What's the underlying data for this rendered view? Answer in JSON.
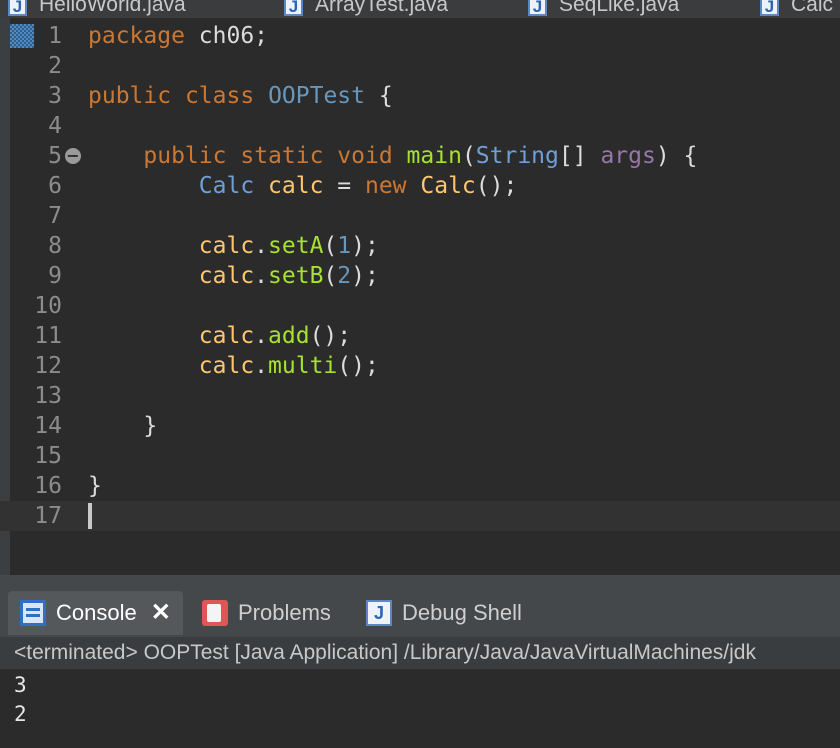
{
  "editor_tabs": [
    "HelloWorld.java",
    "ArrayTest.java",
    "SeqLike.java",
    "Calc"
  ],
  "editor_tab_icon": "J",
  "code_lines": [
    {
      "n": "1",
      "tokens": [
        {
          "t": "package",
          "c": "kw"
        },
        {
          "t": " ch06;",
          "c": "pnc"
        }
      ]
    },
    {
      "n": "2",
      "tokens": []
    },
    {
      "n": "3",
      "tokens": [
        {
          "t": "public",
          "c": "kw"
        },
        {
          "t": " ",
          "c": "pnc"
        },
        {
          "t": "class",
          "c": "kw"
        },
        {
          "t": " ",
          "c": "pnc"
        },
        {
          "t": "OOPTest",
          "c": "cls"
        },
        {
          "t": " {",
          "c": "pnc"
        }
      ]
    },
    {
      "n": "4",
      "tokens": []
    },
    {
      "n": "5",
      "fold": true,
      "tokens": [
        {
          "t": "    ",
          "c": "pnc"
        },
        {
          "t": "public",
          "c": "kw"
        },
        {
          "t": " ",
          "c": "pnc"
        },
        {
          "t": "static",
          "c": "kw"
        },
        {
          "t": " ",
          "c": "pnc"
        },
        {
          "t": "void",
          "c": "kw"
        },
        {
          "t": " ",
          "c": "pnc"
        },
        {
          "t": "main",
          "c": "mth"
        },
        {
          "t": "(",
          "c": "pnc"
        },
        {
          "t": "String",
          "c": "typ"
        },
        {
          "t": "[] ",
          "c": "pnc"
        },
        {
          "t": "args",
          "c": "prm"
        },
        {
          "t": ") {",
          "c": "pnc"
        }
      ]
    },
    {
      "n": "6",
      "tokens": [
        {
          "t": "        ",
          "c": "pnc"
        },
        {
          "t": "Calc",
          "c": "typ"
        },
        {
          "t": " ",
          "c": "pnc"
        },
        {
          "t": "calc",
          "c": "var"
        },
        {
          "t": " = ",
          "c": "pnc"
        },
        {
          "t": "new",
          "c": "kw"
        },
        {
          "t": " ",
          "c": "pnc"
        },
        {
          "t": "Calc",
          "c": "var"
        },
        {
          "t": "();",
          "c": "pnc"
        }
      ]
    },
    {
      "n": "7",
      "tokens": []
    },
    {
      "n": "8",
      "tokens": [
        {
          "t": "        ",
          "c": "pnc"
        },
        {
          "t": "calc",
          "c": "var"
        },
        {
          "t": ".",
          "c": "pnc"
        },
        {
          "t": "setA",
          "c": "mth"
        },
        {
          "t": "(",
          "c": "pnc"
        },
        {
          "t": "1",
          "c": "num"
        },
        {
          "t": ");",
          "c": "pnc"
        }
      ]
    },
    {
      "n": "9",
      "tokens": [
        {
          "t": "        ",
          "c": "pnc"
        },
        {
          "t": "calc",
          "c": "var"
        },
        {
          "t": ".",
          "c": "pnc"
        },
        {
          "t": "setB",
          "c": "mth"
        },
        {
          "t": "(",
          "c": "pnc"
        },
        {
          "t": "2",
          "c": "num"
        },
        {
          "t": ");",
          "c": "pnc"
        }
      ]
    },
    {
      "n": "10",
      "tokens": []
    },
    {
      "n": "11",
      "tokens": [
        {
          "t": "        ",
          "c": "pnc"
        },
        {
          "t": "calc",
          "c": "var"
        },
        {
          "t": ".",
          "c": "pnc"
        },
        {
          "t": "add",
          "c": "mth"
        },
        {
          "t": "();",
          "c": "pnc"
        }
      ]
    },
    {
      "n": "12",
      "tokens": [
        {
          "t": "        ",
          "c": "pnc"
        },
        {
          "t": "calc",
          "c": "var"
        },
        {
          "t": ".",
          "c": "pnc"
        },
        {
          "t": "multi",
          "c": "mth"
        },
        {
          "t": "();",
          "c": "pnc"
        }
      ]
    },
    {
      "n": "13",
      "tokens": []
    },
    {
      "n": "14",
      "tokens": [
        {
          "t": "    }",
          "c": "pnc"
        }
      ]
    },
    {
      "n": "15",
      "tokens": []
    },
    {
      "n": "16",
      "tokens": [
        {
          "t": "}",
          "c": "pnc"
        }
      ]
    },
    {
      "n": "17",
      "current": true,
      "caret": true,
      "tokens": []
    }
  ],
  "panel": {
    "tabs": [
      {
        "label": "Console",
        "icon": "console-icon"
      },
      {
        "label": "Problems",
        "icon": "problems-icon"
      },
      {
        "label": "Debug Shell",
        "icon": "debug-shell-icon"
      }
    ],
    "close_glyph": "✕",
    "debug_icon_letter": "J"
  },
  "console": {
    "status": "<terminated> OOPTest [Java Application] /Library/Java/JavaVirtualMachines/jdk",
    "output": [
      "3",
      "2"
    ]
  },
  "colors": {
    "keyword": "#cc7832",
    "class_name": "#6897bb",
    "variable": "#ffc66d",
    "method": "#a6e22e",
    "parameter": "#9876aa"
  }
}
